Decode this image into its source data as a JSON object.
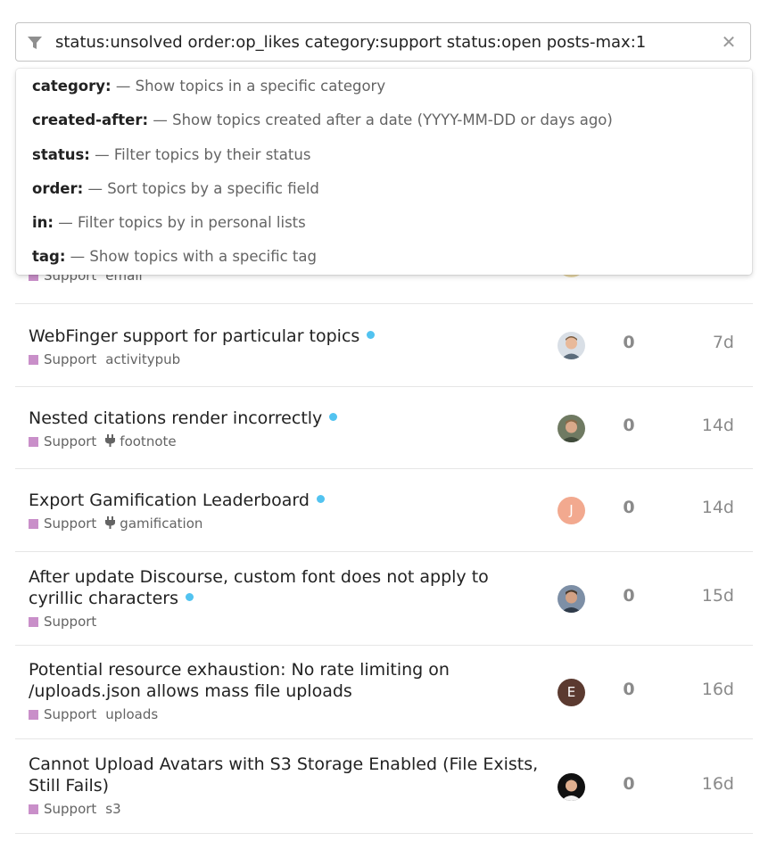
{
  "search": {
    "query": "status:unsolved order:op_likes category:support status:open posts-max:1",
    "clear_icon": "close-icon",
    "filter_icon": "filter-icon"
  },
  "suggestions": [
    {
      "key": "category:",
      "desc": " — Show topics in a specific category"
    },
    {
      "key": "created-after:",
      "desc": " — Show topics created after a date (YYYY-MM-DD or days ago)"
    },
    {
      "key": "status:",
      "desc": " — Filter topics by their status"
    },
    {
      "key": "order:",
      "desc": " — Sort topics by a specific field"
    },
    {
      "key": "in:",
      "desc": " — Filter topics by in personal lists"
    },
    {
      "key": "tag:",
      "desc": " — Show topics with a specific tag"
    }
  ],
  "colors": {
    "category_support": "#c98fc9",
    "unread_dot": "#52c3f0"
  },
  "topics": [
    {
      "title": "",
      "category": "Support",
      "tag": "email",
      "replies": "",
      "activity": ""
    },
    {
      "title": "WebFinger support for particular topics",
      "category": "Support",
      "tag": "activitypub",
      "replies": "0",
      "activity": "7d",
      "avatar": "photo"
    },
    {
      "title": "Nested citations render incorrectly",
      "category": "Support",
      "tag": "footnote",
      "tag_icon": "plug-icon",
      "replies": "0",
      "activity": "14d",
      "avatar": "photo"
    },
    {
      "title": "Export Gamification Leaderboard",
      "category": "Support",
      "tag": "gamification",
      "tag_icon": "plug-icon",
      "replies": "0",
      "activity": "14d",
      "avatar": "J",
      "avatar_color": "#f2a98f"
    },
    {
      "title": "After update Discourse, custom font does not apply to cyrillic characters",
      "category": "Support",
      "tag": "",
      "replies": "0",
      "activity": "15d",
      "avatar": "photo"
    },
    {
      "title": "Potential resource exhaustion: No rate limiting on /uploads.json allows mass file uploads",
      "category": "Support",
      "tag": "uploads",
      "replies": "0",
      "activity": "16d",
      "avatar": "E",
      "avatar_color": "#5b3a30"
    },
    {
      "title": "Cannot Upload Avatars with S3 Storage Enabled (File Exists, Still Fails)",
      "category": "Support",
      "tag": "s3",
      "replies": "0",
      "activity": "16d",
      "avatar": "photo"
    }
  ]
}
